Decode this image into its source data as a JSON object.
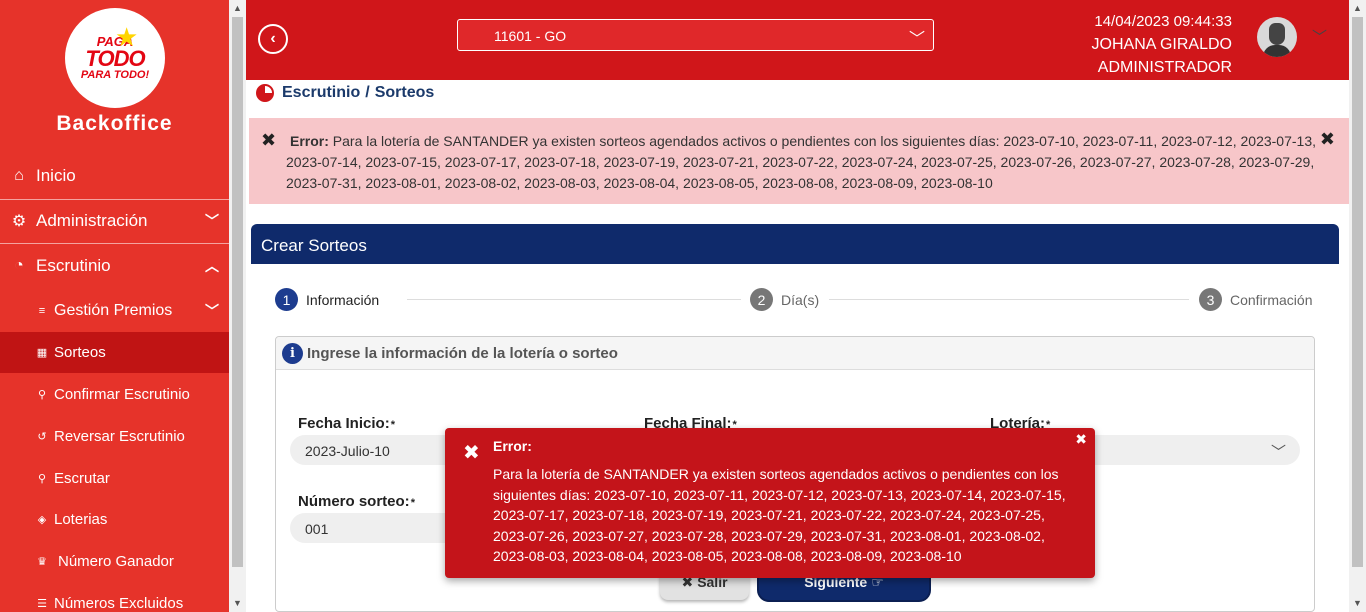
{
  "brand": {
    "logo_line1": "PAGA",
    "logo_line2": "TODO",
    "logo_line3": "PARA TODO!",
    "name": "Backoffice"
  },
  "sidebar": {
    "items": [
      {
        "label": "Inicio",
        "icon": "home-icon"
      },
      {
        "label": "Administración",
        "icon": "gear-icon"
      },
      {
        "label": "Escrutinio",
        "icon": "pie-chart-icon"
      }
    ],
    "subitems": [
      {
        "label": "Gestión Premios",
        "icon": "sliders-icon"
      },
      {
        "label": "Sorteos",
        "icon": "calendar-icon"
      },
      {
        "label": "Confirmar Escrutinio",
        "icon": "search-icon"
      },
      {
        "label": "Reversar Escrutinio",
        "icon": "undo-icon"
      },
      {
        "label": "Escrutar",
        "icon": "search-icon"
      },
      {
        "label": "Loterias",
        "icon": "ticket-icon"
      },
      {
        "label": "Número Ganador",
        "icon": "trophy-icon"
      },
      {
        "label": "Números Excluidos",
        "icon": "list-icon"
      }
    ]
  },
  "header": {
    "select_value": "11601 - GO",
    "datetime": "14/04/2023 09:44:33",
    "user_name": "JOHANA GIRALDO",
    "role": "ADMINISTRADOR"
  },
  "breadcrumb": {
    "section": "Escrutinio",
    "separator": "/",
    "page": "Sorteos"
  },
  "banner": {
    "label": "Error:",
    "message": "Para la lotería de SANTANDER ya existen sorteos agendados activos o pendientes con los siguientes días: 2023-07-10, 2023-07-11, 2023-07-12, 2023-07-13, 2023-07-14, 2023-07-15, 2023-07-17, 2023-07-18, 2023-07-19, 2023-07-21, 2023-07-22, 2023-07-24, 2023-07-25, 2023-07-26, 2023-07-27, 2023-07-28, 2023-07-29, 2023-07-31, 2023-08-01, 2023-08-02, 2023-08-03, 2023-08-04, 2023-08-05, 2023-08-08, 2023-08-09, 2023-08-10"
  },
  "card": {
    "title": "Crear Sorteos",
    "steps": [
      {
        "num": "1",
        "label": "Información"
      },
      {
        "num": "2",
        "label": "Día(s)"
      },
      {
        "num": "3",
        "label": "Confirmación"
      }
    ],
    "info_title": "Ingrese la información de la lotería o sorteo",
    "fields": {
      "fecha_inicio_label": "Fecha Inicio:",
      "fecha_inicio_value": "2023-Julio-10",
      "fecha_final_label": "Fecha Final:",
      "loteria_label": "Lotería:",
      "numero_label": "Número sorteo:",
      "numero_value": "001",
      "required_mark": "*"
    },
    "buttons": {
      "salir": "Salir",
      "siguiente": "Siguiente"
    }
  },
  "toast": {
    "title": "Error:",
    "message": "Para la lotería de SANTANDER ya existen sorteos agendados activos o pendientes con los siguientes días: 2023-07-10, 2023-07-11, 2023-07-12, 2023-07-13, 2023-07-14, 2023-07-15, 2023-07-17, 2023-07-18, 2023-07-19, 2023-07-21, 2023-07-22, 2023-07-24, 2023-07-25, 2023-07-26, 2023-07-27, 2023-07-28, 2023-07-29, 2023-07-31, 2023-08-01, 2023-08-02, 2023-08-03, 2023-08-04, 2023-08-05, 2023-08-08, 2023-08-09, 2023-08-10"
  },
  "colors": {
    "sidebar": "#e6332a",
    "topbar": "#d0161a",
    "navy": "#0f2a6b",
    "banner": "#f7c6c9",
    "toast": "#c4141a"
  }
}
